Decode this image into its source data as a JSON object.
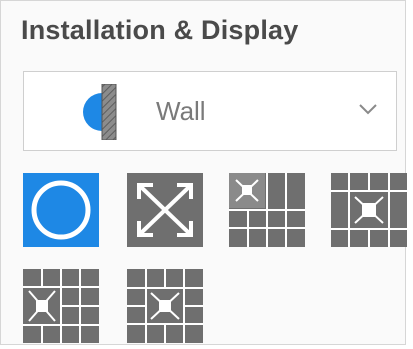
{
  "panel": {
    "title": "Installation & Display"
  },
  "mount_select": {
    "icon": "wall-mount-icon",
    "selected": "Wall"
  },
  "display_modes": [
    {
      "icon": "fisheye-view-icon",
      "selected": true
    },
    {
      "icon": "panorama-expand-icon",
      "selected": false
    },
    {
      "icon": "one-plus-three-layout-icon",
      "selected": false
    },
    {
      "icon": "one-plus-eight-layout-icon",
      "selected": false
    },
    {
      "icon": "one-plus-six-layout-icon",
      "selected": false
    },
    {
      "icon": "one-plus-twelve-layout-icon",
      "selected": false
    }
  ],
  "colors": {
    "accent": "#1e88e5",
    "tile_gray": "#6f6f6f"
  }
}
